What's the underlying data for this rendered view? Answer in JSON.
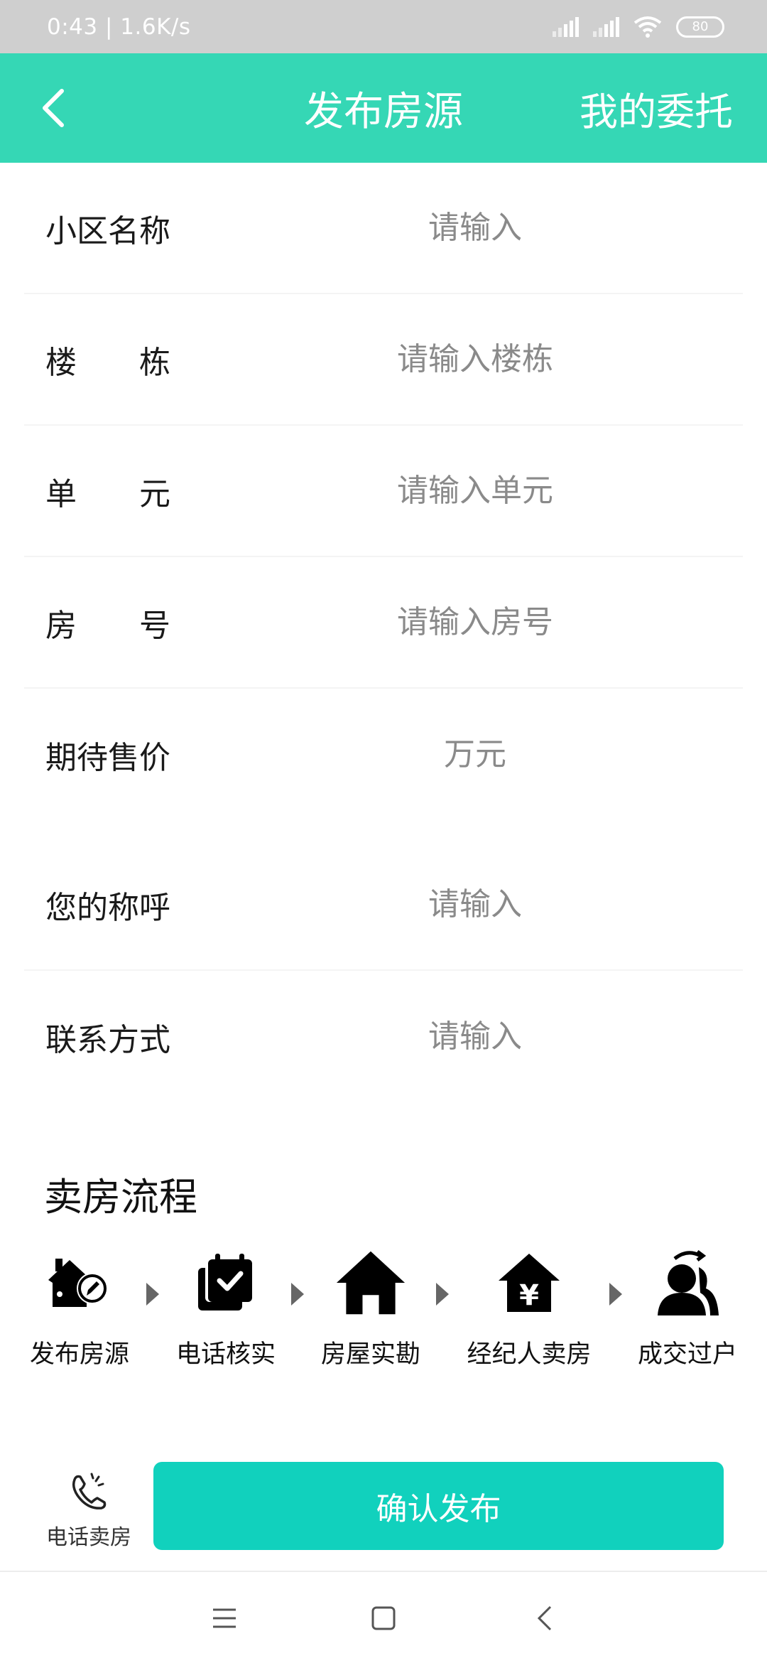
{
  "status_bar": {
    "time_speed": "0:43 | 1.6K/s",
    "battery": "80"
  },
  "header": {
    "title": "发布房源",
    "right_action": "我的委托"
  },
  "form": {
    "community": {
      "label": "小区名称",
      "placeholder": "请输入"
    },
    "building": {
      "label": "楼　　栋",
      "placeholder": "请输入楼栋"
    },
    "unit": {
      "label": "单　　元",
      "placeholder": "请输入单元"
    },
    "room": {
      "label": "房　　号",
      "placeholder": "请输入房号"
    },
    "price": {
      "label": "期待售价",
      "placeholder": "万元"
    },
    "name": {
      "label": "您的称呼",
      "placeholder": "请输入"
    },
    "contact": {
      "label": "联系方式",
      "placeholder": "请输入"
    }
  },
  "process": {
    "title": "卖房流程",
    "steps": [
      {
        "label": "发布房源",
        "icon": "house-edit-icon"
      },
      {
        "label": "电话核实",
        "icon": "calendar-check-icon"
      },
      {
        "label": "房屋实勘",
        "icon": "house-icon"
      },
      {
        "label": "经纪人卖房",
        "icon": "house-yen-icon"
      },
      {
        "label": "成交过户",
        "icon": "user-transfer-icon"
      }
    ]
  },
  "bottom": {
    "phone_sell_label": "电话卖房",
    "confirm_label": "确认发布"
  },
  "colors": {
    "accent": "#35d7b5",
    "button": "#11d1bd"
  }
}
